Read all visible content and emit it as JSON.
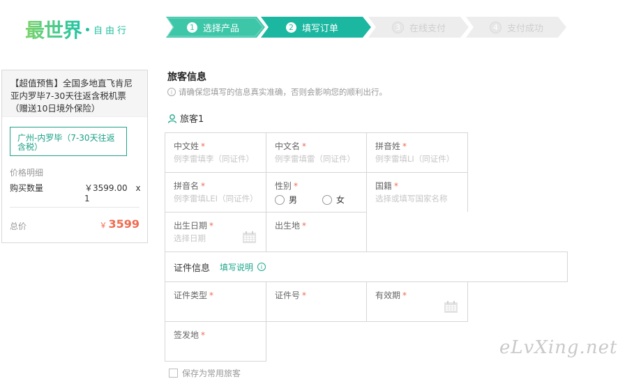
{
  "logo": {
    "main": "最世界",
    "sub": "自由行"
  },
  "steps": [
    {
      "num": "1",
      "label": "选择产品",
      "state": "done"
    },
    {
      "num": "2",
      "label": "填写订单",
      "state": "active"
    },
    {
      "num": "3",
      "label": "在线支付",
      "state": "todo"
    },
    {
      "num": "4",
      "label": "支付成功",
      "state": "todo"
    }
  ],
  "order": {
    "title": "【超值预售】全国多地直飞肯尼亚内罗毕7-30天往返含税机票（赠送10日境外保险）",
    "route": "广州-内罗毕（7-30天往返含税）",
    "detail_label": "价格明细",
    "qty_label": "购买数量",
    "unit_price": "￥3599.00",
    "qty": "x 1",
    "total_label": "总价",
    "total_currency": "￥",
    "total": "3599"
  },
  "form": {
    "section_title": "旅客信息",
    "notice": "请确保您填写的信息真实准确，否则会影响您的顺利出行。",
    "traveler": "旅客1",
    "fields": {
      "cn_surname": {
        "label": "中文姓",
        "placeholder": "例李雷填李（同证件）"
      },
      "cn_name": {
        "label": "中文名",
        "placeholder": "例李雷填雷（同证件）"
      },
      "py_surname": {
        "label": "拼音姓",
        "placeholder": "例李雷填LI（同证件）"
      },
      "py_name": {
        "label": "拼音名",
        "placeholder": "例李雷填LEI（同证件）"
      },
      "gender": {
        "label": "性别",
        "male": "男",
        "female": "女"
      },
      "nationality": {
        "label": "国籍",
        "placeholder": "选择或填写国家名称"
      },
      "birth_date": {
        "label": "出生日期",
        "placeholder": "选择日期"
      },
      "birth_place": {
        "label": "出生地"
      },
      "cert_type": {
        "label": "证件类型"
      },
      "cert_no": {
        "label": "证件号"
      },
      "valid_until": {
        "label": "有效期"
      },
      "issue_place": {
        "label": "签发地"
      }
    },
    "required_mark": "*",
    "cert_section": {
      "title": "证件信息",
      "help_link": "填写说明"
    },
    "save_label": "保存为常用旅客"
  },
  "watermark": "eLvXing.net"
}
